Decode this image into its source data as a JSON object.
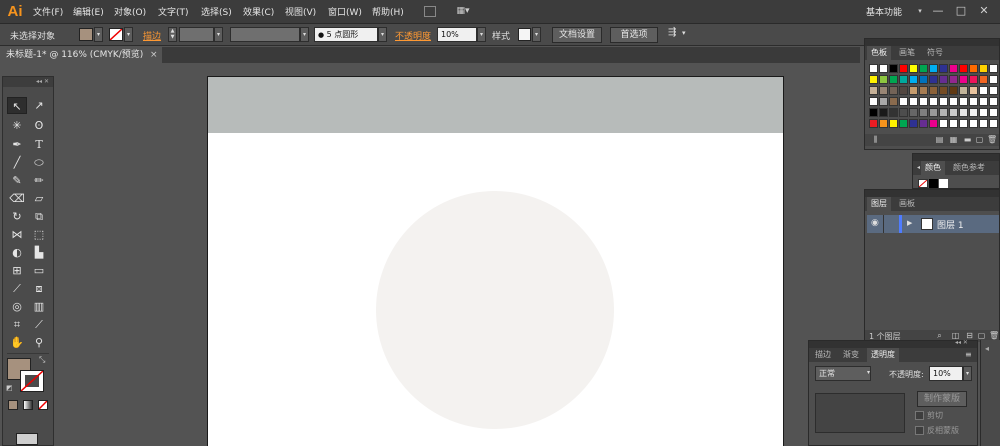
{
  "app": {
    "logo": "Ai",
    "workspace": "基本功能"
  },
  "menu": [
    "文件(F)",
    "编辑(E)",
    "对象(O)",
    "文字(T)",
    "选择(S)",
    "效果(C)",
    "视图(V)",
    "窗口(W)",
    "帮助(H)"
  ],
  "control": {
    "selection_label": "未选择对象",
    "stroke_label": "描边",
    "brush_value": "5 点圆形",
    "opacity_label": "不透明度",
    "opacity_value": "10%",
    "style_label": "样式",
    "doc_setup": "文档设置",
    "prefs": "首选项"
  },
  "document": {
    "tab_title": "未标题-1* @ 116% (CMYK/预览)",
    "close": "×"
  },
  "colors": {
    "fill": "#a6917e",
    "header_band": "#b7bbba",
    "circle": "#f4f2f0",
    "accent": "#f7941d"
  },
  "swatches_panel": {
    "tabs": [
      "色板",
      "画笔",
      "符号"
    ],
    "rows": [
      [
        "#ffffff",
        "#ffffff",
        "#000000",
        "#ff0000",
        "#ffff00",
        "#00a651",
        "#00aeef",
        "#2e3192",
        "#ec008c",
        "#ff0000",
        "#ff6a00",
        "#ffd200",
        "#ffffff"
      ],
      [
        "#fff200",
        "#8dc63f",
        "#00a651",
        "#00a99d",
        "#00aeef",
        "#0072bc",
        "#2e3192",
        "#662d91",
        "#92278f",
        "#ec008c",
        "#ed145b",
        "#f26522",
        "#ffffff"
      ],
      [
        "#c7b299",
        "#998675",
        "#736357",
        "#534741",
        "#c69c6d",
        "#a67c52",
        "#8c6239",
        "#754c24",
        "#603913",
        "#c2b59b",
        "#e8c39e",
        "#ffffff",
        "#ffffff"
      ],
      [
        "#ffffff",
        "#aaaaaa",
        "#8a6b4e",
        "#ffffff",
        "#ffffff",
        "#ffffff",
        "#ffffff",
        "#ffffff",
        "#ffffff",
        "#ffffff",
        "#ffffff",
        "#ffffff",
        "#ffffff"
      ],
      [
        "#000000",
        "#1a1a1a",
        "#333333",
        "#4d4d4d",
        "#666666",
        "#808080",
        "#999999",
        "#b3b3b3",
        "#cccccc",
        "#e6e6e6",
        "#f2f2f2",
        "#ffffff",
        "#ffffff"
      ],
      [
        "#ed1c24",
        "#f7941d",
        "#fff200",
        "#00a651",
        "#2e3192",
        "#662d91",
        "#ec008c",
        "#ffffff",
        "#ffffff",
        "#ffffff",
        "#ffffff",
        "#ffffff",
        "#ffffff"
      ]
    ]
  },
  "color_panel": {
    "tabs": [
      "颜色",
      "颜色参考"
    ]
  },
  "layers_panel": {
    "tabs": [
      "图层",
      "画板"
    ],
    "layer_name": "图层 1",
    "footer": "1 个图层"
  },
  "transparency_panel": {
    "tabs": [
      "描边",
      "渐变",
      "透明度"
    ],
    "blend_mode": "正常",
    "opacity_label": "不透明度:",
    "opacity_value": "10%",
    "make_mask": "制作蒙版",
    "clip": "剪切",
    "invert_mask": "反相蒙版"
  }
}
